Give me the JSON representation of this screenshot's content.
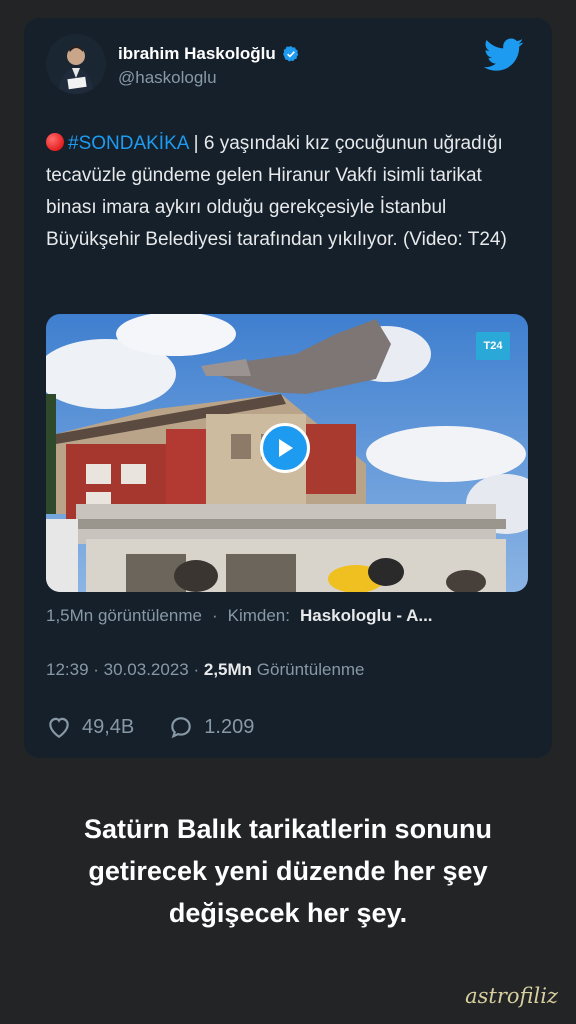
{
  "tweet": {
    "author_name": "ibrahim Haskoloğlu",
    "handle": "@haskologlu",
    "text_hashtag": "#SONDAKİKA",
    "text_body": " | 6 yaşındaki kız çocuğunun uğradığı tecavüzle gündeme gelen Hiranur Vakfı isimli tarikat binası imara aykırı olduğu gerekçesiyle İstanbul Büyükşehir Belediyesi tarafından yıkılıyor. (Video: T24)",
    "video_badge": "T24",
    "video_views": "1,5Mn görüntülenme",
    "from_label": "Kimden:",
    "from_source": "Haskologlu - A...",
    "time": "12:39 · 30.03.2023 ·",
    "views_count": "2,5Mn",
    "views_label": "Görüntülenme",
    "likes": "49,4B",
    "replies": "1.209"
  },
  "caption": {
    "line1": "Satürn Balık tarikatlerin sonunu",
    "line2": "getirecek yeni düzende her şey",
    "line3": "değişecek her şey."
  },
  "signature": "astrofiliz",
  "icons": {
    "verified": "verified-badge-icon",
    "brand": "twitter-bird-icon",
    "play": "play-icon",
    "like": "heart-icon",
    "reply": "reply-bubble-icon"
  },
  "colors": {
    "card_bg": "#15202b",
    "page_bg": "#222426",
    "accent": "#1d9bf0",
    "muted": "#8899a6"
  }
}
